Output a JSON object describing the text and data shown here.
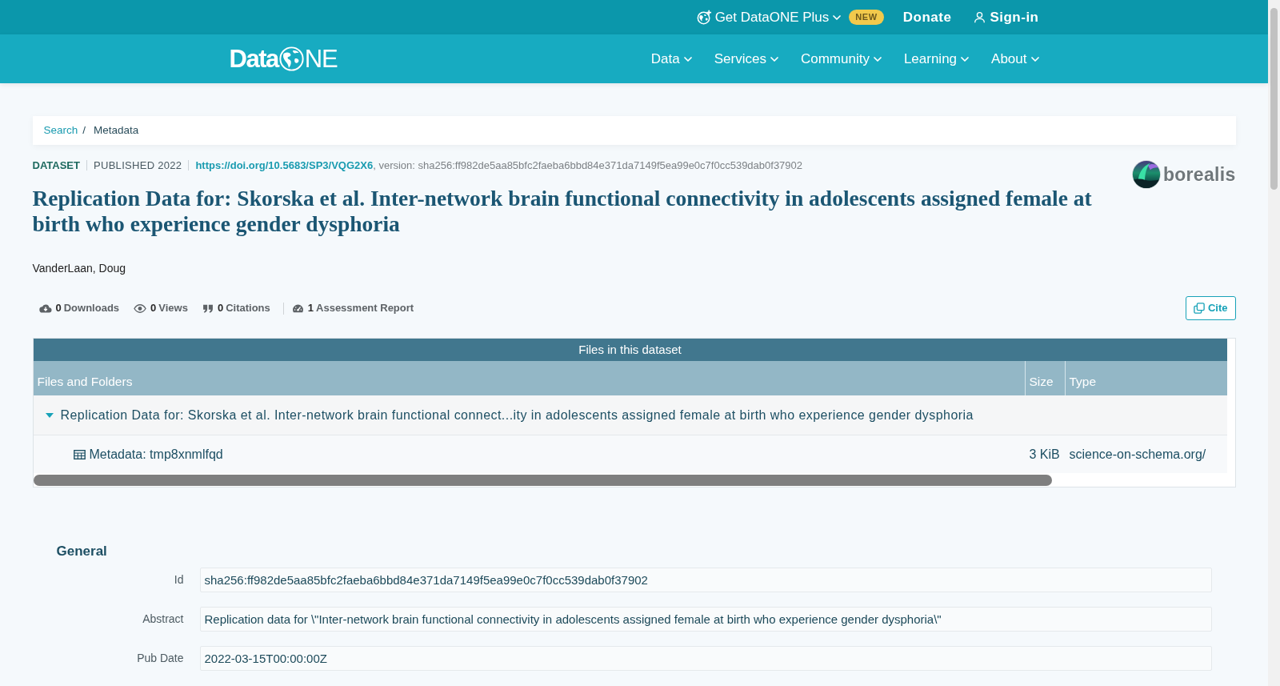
{
  "top_bar": {
    "items": [
      {
        "kind": "dropdown",
        "label": "Get DataONE Plus",
        "badge": "NEW"
      },
      {
        "kind": "link",
        "label": "Donate"
      },
      {
        "kind": "account",
        "label": "Sign-in"
      }
    ]
  },
  "navbar": {
    "logo": {
      "left": "Data",
      "right": "NE"
    },
    "items": [
      {
        "label": "Data"
      },
      {
        "label": "Services"
      },
      {
        "label": "Community"
      },
      {
        "label": "Learning"
      },
      {
        "label": "About"
      }
    ]
  },
  "breadcrumb": {
    "separator": "/",
    "items": [
      {
        "kind": "link",
        "label": "Search"
      },
      {
        "kind": "current",
        "label": "Metadata"
      }
    ]
  },
  "dataset": {
    "type": "DATASET",
    "published": "PUBLISHED 2022",
    "doi": "https://doi.org/10.5683/SP3/VQG2X6",
    "version": ", version: sha256:ff982de5aa85bfc2faeba6bbd84e371da7149f5ea99e0c7f0cc539dab0f37902",
    "repository": "borealis",
    "title": "Replication Data for: Skorska et al. Inter-network brain functional connectivity in adolescents assigned female at birth who experience gender dysphoria",
    "authors": [
      "VanderLaan, Doug"
    ],
    "metrics": [
      {
        "kind": "downloads",
        "count": "0",
        "label": "Downloads"
      },
      {
        "kind": "views",
        "count": "0",
        "label": "Views"
      },
      {
        "kind": "citations",
        "count": "0",
        "label": "Citations"
      },
      {
        "kind": "assessment",
        "count": "1",
        "label": "Assessment Report"
      }
    ],
    "cite_button": "Cite"
  },
  "files": {
    "title": "Files in this dataset",
    "columns": [
      "Files and Folders",
      "Size",
      "Type"
    ],
    "rows": [
      {
        "kind": "folder",
        "expanded": true,
        "name": "Replication Data for: Skorska et al. Inter-network brain functional connect...ity in adolescents assigned female at birth who experience gender dysphoria",
        "children": [
          {
            "kind": "file",
            "name": "Metadata: tmp8xnmlfqd",
            "size": "3 KiB",
            "type": "science-on-schema.org/"
          }
        ]
      }
    ]
  },
  "general": {
    "heading": "General",
    "fields": [
      {
        "label": "Id",
        "value": "sha256:ff982de5aa85bfc2faeba6bbd84e371da7149f5ea99e0c7f0cc539dab0f37902"
      },
      {
        "label": "Abstract",
        "value": "Replication data for \\\"Inter-network brain functional connectivity in adolescents assigned female at birth who experience gender dysphoria\\\""
      },
      {
        "label": "Pub Date",
        "value": "2022-03-15T00:00:00Z"
      }
    ]
  }
}
